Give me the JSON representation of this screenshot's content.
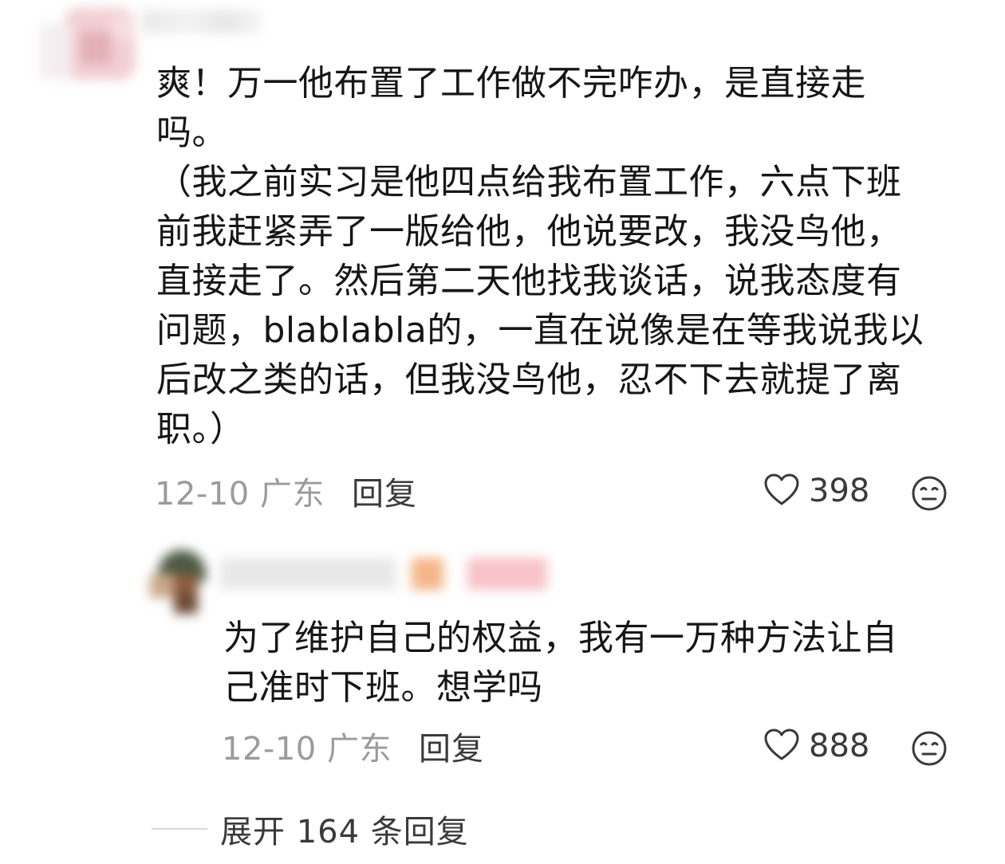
{
  "main_comment": {
    "text": "爽！万一他布置了工作做不完咋办，是直接走\n吗。\n（我之前实习是他四点给我布置工作，六点下班\n前我赶紧弄了一版给他，他说要改，我没鸟他，\n直接走了。然后第二天他找我谈话，说我态度有\n问题，blablabla的，一直在说像是在等我说我以\n后改之类的话，但我没鸟他，忍不下去就提了离\n职。）",
    "date_location": "12-10 广东",
    "reply_label": "回复",
    "like_count": "398",
    "icons": {
      "like": "heart-outline-icon",
      "reaction": "neutral-face-icon"
    }
  },
  "reply_comment": {
    "text": "为了维护自己的权益，我有一万种方法让自\n己准时下班。想学吗",
    "date_location": "12-10 广东",
    "reply_label": "回复",
    "like_count": "888",
    "icons": {
      "like": "heart-outline-icon",
      "reaction": "neutral-face-icon"
    }
  },
  "expand_replies": {
    "label": "展开 164 条回复"
  },
  "colors": {
    "text_primary": "#161616",
    "text_secondary": "#9b9b9b",
    "action_text": "#3a3a3a",
    "divider": "#d8d8d8"
  }
}
